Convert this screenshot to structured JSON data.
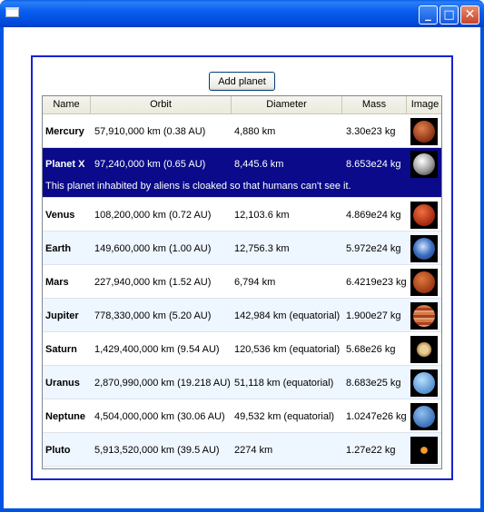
{
  "columns": [
    "Name",
    "Orbit",
    "Diameter",
    "Mass",
    "Image"
  ],
  "toolbar": {
    "add_label": "Add planet"
  },
  "planets": [
    {
      "name": "Mercury",
      "orbit": "57,910,000 km (0.38 AU)",
      "diameter": "4,880 km",
      "mass": "3.30e23 kg",
      "image": "mercury-icon"
    },
    {
      "name": "Planet X",
      "orbit": "97,240,000 km (0.65 AU)",
      "diameter": "8,445.6 km",
      "mass": "8.653e24 kg",
      "image": "planet-x-icon",
      "detail": "This planet inhabited by aliens is cloaked so that humans can't see it."
    },
    {
      "name": "Venus",
      "orbit": "108,200,000 km (0.72 AU)",
      "diameter": "12,103.6 km",
      "mass": "4.869e24 kg",
      "image": "venus-icon"
    },
    {
      "name": "Earth",
      "orbit": "149,600,000 km (1.00 AU)",
      "diameter": "12,756.3 km",
      "mass": "5.972e24 kg",
      "image": "earth-icon"
    },
    {
      "name": "Mars",
      "orbit": "227,940,000 km (1.52 AU)",
      "diameter": "6,794 km",
      "mass": "6.4219e23 kg",
      "image": "mars-icon"
    },
    {
      "name": "Jupiter",
      "orbit": "778,330,000 km (5.20 AU)",
      "diameter": "142,984 km (equatorial)",
      "mass": "1.900e27 kg",
      "image": "jupiter-icon"
    },
    {
      "name": "Saturn",
      "orbit": "1,429,400,000 km (9.54 AU)",
      "diameter": "120,536 km (equatorial)",
      "mass": "5.68e26 kg",
      "image": "saturn-icon"
    },
    {
      "name": "Uranus",
      "orbit": "2,870,990,000 km (19.218 AU)",
      "diameter": "51,118 km (equatorial)",
      "mass": "8.683e25 kg",
      "image": "uranus-icon"
    },
    {
      "name": "Neptune",
      "orbit": "4,504,000,000 km (30.06 AU)",
      "diameter": "49,532 km (equatorial)",
      "mass": "1.0247e26 kg",
      "image": "neptune-icon"
    },
    {
      "name": "Pluto",
      "orbit": "5,913,520,000 km (39.5 AU)",
      "diameter": "2274 km",
      "mass": "1.27e22 kg",
      "image": "pluto-icon"
    }
  ],
  "colors": {
    "title_bar": "#0054e3",
    "frame_border": "#1722d0",
    "selected_row": "#0a0a8a",
    "alt_row": "#eef6ff"
  }
}
